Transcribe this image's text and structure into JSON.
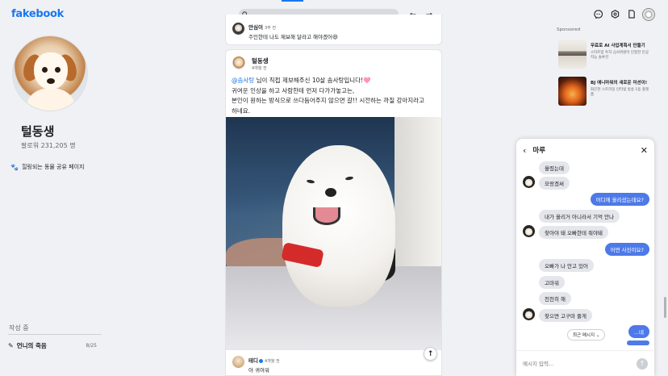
{
  "app": {
    "logo": "fakebook"
  },
  "profile": {
    "name": "털동생",
    "followers": "팔로워 231,205 명",
    "description": "힐링되는 동물 공유 페이지"
  },
  "drafts": {
    "label": "작성 중",
    "item_title": "언니의 죽음",
    "item_count": "8/25"
  },
  "search": {
    "placeholder": ""
  },
  "top_icons": [
    "messenger-icon",
    "settings-icon",
    "bookmark-icon",
    "profile-avatar"
  ],
  "comment_top": {
    "author": "안심이",
    "time": "3주 전",
    "text": "주인한테 나도 제보해 달라고 해야겠어😆"
  },
  "post": {
    "author": "털동생",
    "time": "4개월 전",
    "mention": "@솜사탕",
    "text_after_mention": " 님이 직접 제보해주신 10살 솜사탕입니다!🩷",
    "line2": "귀여운 인상을 하고 사람한테 먼저 다가가놓고는,",
    "line3": "본인이 원하는 방식으로 쓰다듬어주지 않으면 갈!! 시전하는 까칠 강아지라고",
    "line4": "하네요."
  },
  "post_comment": {
    "author": "테디",
    "time": "4개월 전",
    "text": "아 귀여워"
  },
  "sponsored": {
    "label": "Sponsored",
    "ads": [
      {
        "title": "무료로 AI 사업계획서 만들기",
        "desc": "스타트업 투자 심사위원이 인정한 인공지능 솔루션"
      },
      {
        "title": "BJ 애니마워의 새로운 미션이!",
        "desc": "화끈한 스트리밍 인터넷 방송 1등 플랫폼"
      }
    ]
  },
  "chat": {
    "title": "마루",
    "messages": [
      {
        "dir": "in",
        "text": "올렸는데",
        "avatar": false
      },
      {
        "dir": "in",
        "text": "모랑겠써",
        "avatar": true
      },
      {
        "dir": "out",
        "text": "어디에 올리셨는데요?"
      },
      {
        "dir": "in",
        "text": "내가 올리거 아니라서  기억 안나",
        "avatar": false
      },
      {
        "dir": "in",
        "text": "찾아야 돼  오빠한테 줘야돼",
        "avatar": true
      },
      {
        "dir": "out",
        "text": "어떤 사진이요?"
      },
      {
        "dir": "in",
        "text": "오빠가 나 안고  있어",
        "avatar": false
      },
      {
        "dir": "in",
        "text": "고마워",
        "avatar": false
      },
      {
        "dir": "in",
        "text": "천천히 해",
        "avatar": false
      },
      {
        "dir": "in",
        "text": "찾으면  고구마  줄게",
        "avatar": true
      },
      {
        "dir": "out",
        "text": "...네"
      }
    ],
    "recent_button": "최근 메시지",
    "input_placeholder": "메시지 입력..."
  },
  "colors": {
    "brand": "#1877f2",
    "outgoing_bubble": "#4e7ae8",
    "incoming_bubble": "#e4e6eb"
  }
}
